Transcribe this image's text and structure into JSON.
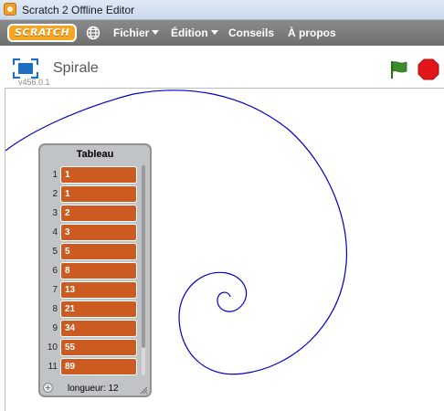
{
  "window": {
    "title": "Scratch 2 Offline Editor"
  },
  "menubar": {
    "logo": "SCRATCH",
    "language_icon": "globe-icon",
    "items": [
      {
        "label": "Fichier",
        "dropdown": true
      },
      {
        "label": "Édition",
        "dropdown": true
      },
      {
        "label": "Conseils",
        "dropdown": false
      },
      {
        "label": "À propos",
        "dropdown": false
      }
    ]
  },
  "stage_header": {
    "project_title": "Spirale",
    "version": "v456.0.1",
    "fullscreen_icon": "fullscreen-icon",
    "flag_icon": "green-flag-icon",
    "stop_icon": "stop-icon"
  },
  "list_monitor": {
    "title": "Tableau",
    "rows": [
      {
        "index": "1",
        "value": "1"
      },
      {
        "index": "2",
        "value": "1"
      },
      {
        "index": "3",
        "value": "2"
      },
      {
        "index": "4",
        "value": "3"
      },
      {
        "index": "5",
        "value": "5"
      },
      {
        "index": "6",
        "value": "8"
      },
      {
        "index": "7",
        "value": "13"
      },
      {
        "index": "8",
        "value": "21"
      },
      {
        "index": "9",
        "value": "34"
      },
      {
        "index": "10",
        "value": "55"
      },
      {
        "index": "11",
        "value": "89"
      }
    ],
    "length_label": "longueur: 12"
  },
  "colors": {
    "menubar": "#7a7a7a",
    "logo": "#f6a623",
    "list_cell": "#cc5b22",
    "spiral_pen": "#0000cc",
    "flag": "#3b8a2b",
    "stop": "#e0161b",
    "fullscreen": "#1d6fc2"
  }
}
